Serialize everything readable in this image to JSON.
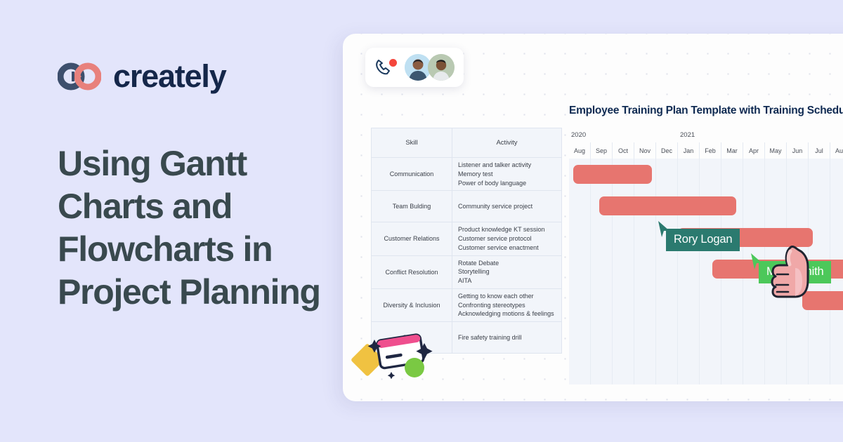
{
  "brand": {
    "logo_icon": "creately-rings-icon",
    "name": "creately",
    "colors": {
      "navy": "#15274a",
      "salmon": "#e7756f",
      "background": "#e3e5fb"
    }
  },
  "headline": "Using Gantt Charts and Flowcharts in Project Planning",
  "canvas": {
    "call_chip": {
      "phone_icon": "phone-handset-icon",
      "recording_dot": "recording-dot-icon",
      "avatars": [
        "avatar-user-1",
        "avatar-user-2"
      ]
    },
    "doodles": [
      "yellow-diamond",
      "card-illustration",
      "star-small",
      "star-large",
      "green-circle"
    ],
    "thumbs_up_icon": "thumbs-up-icon"
  },
  "gantt": {
    "title": "Employee Training Plan Template with Training Schedule Ga",
    "table": {
      "headers": [
        "Skill",
        "Activity"
      ],
      "rows": [
        {
          "skill": "Communication",
          "activities": [
            "Listener and talker activity",
            "Memory test",
            "Power of body language"
          ]
        },
        {
          "skill": "Team Bulding",
          "activities": [
            "Community service project"
          ]
        },
        {
          "skill": "Customer Relations",
          "activities": [
            "Product knowledge KT session",
            "Customer service protocol",
            "Customer service enactment"
          ]
        },
        {
          "skill": "Conflict Resolution",
          "activities": [
            "Rotate Debate",
            "Storytelling",
            "AITA"
          ]
        },
        {
          "skill": "Diversity & Inclusion",
          "activities": [
            "Getting to know each other",
            "Confronting stereotypes",
            "Acknowledging motions & feelings"
          ]
        },
        {
          "skill": "Safety",
          "activities": [
            "Fire safety training drill"
          ]
        }
      ]
    },
    "timeline": {
      "years": [
        "2020",
        "2021"
      ],
      "months": [
        "Aug",
        "Sep",
        "Oct",
        "Nov",
        "Dec",
        "Jan",
        "Feb",
        "Mar",
        "Apr",
        "May",
        "Jun",
        "Jul",
        "Aug"
      ]
    },
    "collaborators": [
      {
        "name": "Rory Logan",
        "color": "#2b7a6f"
      },
      {
        "name": "Mark Smith",
        "color": "#4cc85a"
      }
    ]
  },
  "chart_data": {
    "type": "bar",
    "title": "Employee Training Plan Template with Training Schedule Ga",
    "xlabel": "",
    "ylabel": "Skill",
    "categories": [
      "Communication",
      "Team Bulding",
      "Customer Relations",
      "Conflict Resolution",
      "Diversity & Inclusion",
      "Safety"
    ],
    "x_ticks": [
      "Aug",
      "Sep",
      "Oct",
      "Nov",
      "Dec",
      "Jan",
      "Feb",
      "Mar",
      "Apr",
      "May",
      "Jun",
      "Jul",
      "Aug"
    ],
    "x_groups": [
      {
        "label": "2020",
        "months": [
          "Aug",
          "Sep",
          "Oct",
          "Nov",
          "Dec"
        ]
      },
      {
        "label": "2021",
        "months": [
          "Jan",
          "Feb",
          "Mar",
          "Apr",
          "May",
          "Jun",
          "Jul",
          "Aug"
        ]
      }
    ],
    "bar_color": "#e7756f",
    "grid": true,
    "legend": false,
    "bars": [
      {
        "task": "Communication",
        "start_month": "Aug",
        "end_month": "Oct",
        "start_index": 0,
        "span": 3.6
      },
      {
        "task": "Team Bulding",
        "start_month": "Sep",
        "end_month": "Jan",
        "start_index": 1.2,
        "span": 6.3
      },
      {
        "task": "Customer Relations",
        "start_month": "Jan",
        "end_month": "Apr",
        "start_index": 4.8,
        "span": 6.2
      },
      {
        "task": "Conflict Resolution",
        "start_month": "Mar",
        "end_month": "Jun",
        "start_index": 6.4,
        "span": 6.4
      },
      {
        "task": "Diversity & Inclusion",
        "start_month": "Jun",
        "end_month": "Aug",
        "start_index": 10.5,
        "span": 3.5
      }
    ]
  }
}
